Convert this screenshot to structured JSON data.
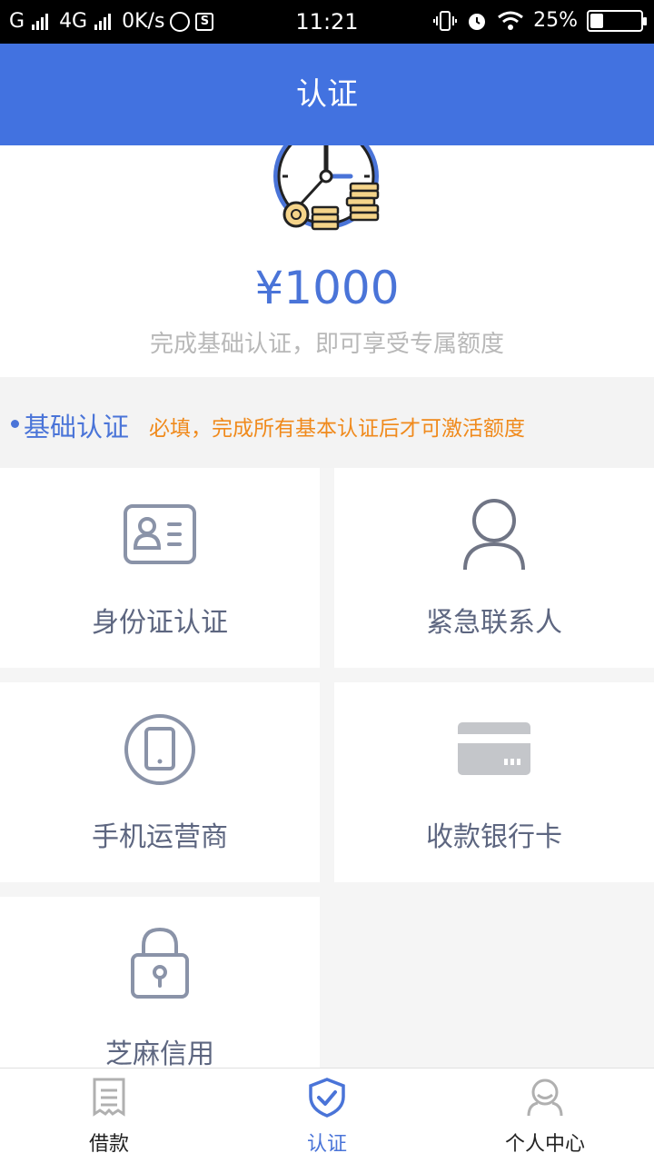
{
  "status_bar": {
    "carrier1": "G",
    "carrier2": "4G",
    "speed": "0K/s",
    "s_badge": "S",
    "time": "11:21",
    "battery": "25%",
    "battery_level": 0.25
  },
  "header": {
    "title": "认证"
  },
  "hero": {
    "amount": "¥1000",
    "subtitle": "完成基础认证，即可享受专属额度",
    "illustration": "clock-coins-icon"
  },
  "section": {
    "title": "基础认证",
    "note": "必填，完成所有基本认证后才可激活额度"
  },
  "cards": [
    {
      "label": "身份证认证",
      "icon": "id-card-icon"
    },
    {
      "label": "紧急联系人",
      "icon": "person-icon"
    },
    {
      "label": "手机运营商",
      "icon": "phone-icon"
    },
    {
      "label": "收款银行卡",
      "icon": "bank-card-icon"
    },
    {
      "label": "芝麻信用",
      "icon": "lock-icon"
    }
  ],
  "tabs": [
    {
      "label": "借款",
      "icon": "receipt-icon",
      "active": false
    },
    {
      "label": "认证",
      "icon": "shield-check-icon",
      "active": true
    },
    {
      "label": "个人中心",
      "icon": "user-icon",
      "active": false
    }
  ],
  "colors": {
    "primary": "#4272e0",
    "amount": "#4a74d8",
    "note": "#f08a1c",
    "card_label": "#5d6680",
    "icon_gray": "#8a93a8"
  }
}
